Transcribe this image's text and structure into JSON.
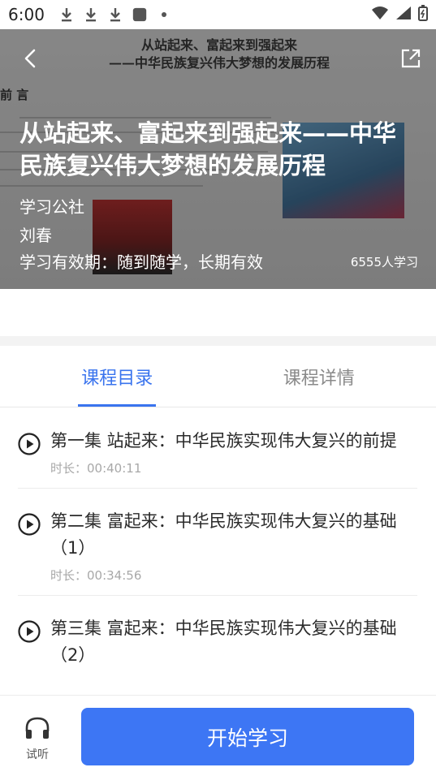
{
  "status_bar": {
    "time": "6:00",
    "icons": [
      "download-icon",
      "download-icon",
      "download-icon",
      "app-icon",
      "dot-icon",
      "wifi-icon",
      "signal-icon",
      "battery-icon"
    ]
  },
  "hero": {
    "doc_heading_line1": "从站起来、富起来到强起来",
    "doc_heading_line2": "——中华民族复兴伟大梦想的发展历程",
    "doc_section": "前 言",
    "title": "从站起来、富起来到强起来——中华民族复兴伟大梦想的发展历程",
    "publisher": "学习公社",
    "author": "刘春",
    "validity": "学习有效期：随到随学，长期有效",
    "learners": "6555人学习"
  },
  "tabs": [
    {
      "label": "课程目录",
      "active": true
    },
    {
      "label": "课程详情",
      "active": false
    }
  ],
  "episodes": [
    {
      "title": "第一集 站起来：中华民族实现伟大复兴的前提",
      "duration": "时长：00:40:11"
    },
    {
      "title": "第二集 富起来：中华民族实现伟大复兴的基础（1）",
      "duration": "时长：00:34:56"
    },
    {
      "title": "第三集 富起来：中华民族实现伟大复兴的基础（2）",
      "duration": ""
    }
  ],
  "bottom": {
    "listen_label": "试听",
    "start_label": "开始学习"
  },
  "colors": {
    "accent": "#3a74ee",
    "button": "#3d76f4"
  }
}
